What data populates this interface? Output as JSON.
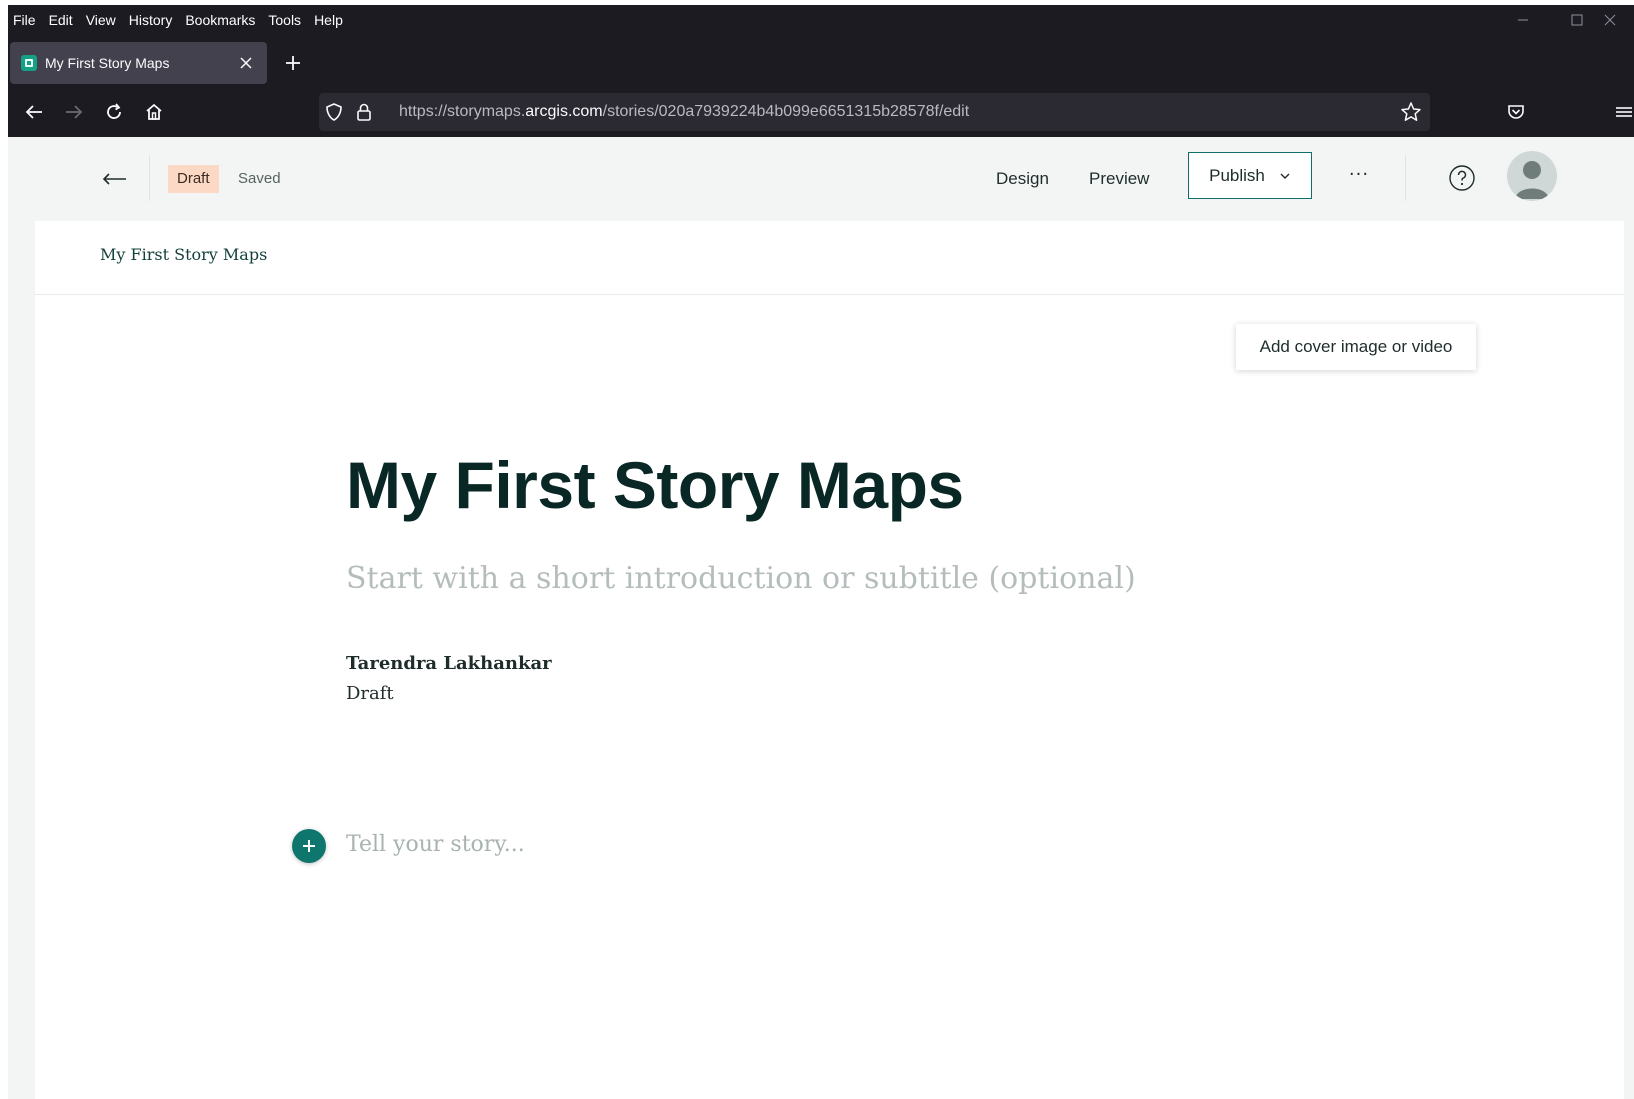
{
  "browser": {
    "menu": [
      "File",
      "Edit",
      "View",
      "History",
      "Bookmarks",
      "Tools",
      "Help"
    ],
    "tab": {
      "title": "My First Story Maps"
    },
    "url": {
      "prefix": "https://storymaps.",
      "host": "arcgis.com",
      "path": "/stories/020a7939224b4b099e6651315b28578f/edit"
    }
  },
  "header": {
    "status_badge": "Draft",
    "save_state": "Saved",
    "design_label": "Design",
    "preview_label": "Preview",
    "publish_label": "Publish",
    "more_label": "···"
  },
  "story": {
    "nav_title": "My First Story Maps",
    "cover_button": "Add cover image or video",
    "title": "My First Story Maps",
    "subtitle_placeholder": "Start with a short introduction or subtitle (optional)",
    "author": "Tarendra Lakhankar",
    "status": "Draft",
    "body_placeholder": "Tell your story..."
  },
  "colors": {
    "accent": "#0f766e",
    "draft_badge_bg": "#fcd9c4",
    "chrome_bg": "#1c1b22"
  },
  "icons": {
    "back": "back-arrow-icon",
    "forward": "forward-arrow-icon",
    "reload": "reload-icon",
    "home": "home-icon",
    "shield": "shield-icon",
    "lock": "lock-icon",
    "bookmark": "star-icon",
    "pocket": "pocket-icon",
    "help": "help-icon",
    "add": "plus-icon"
  }
}
